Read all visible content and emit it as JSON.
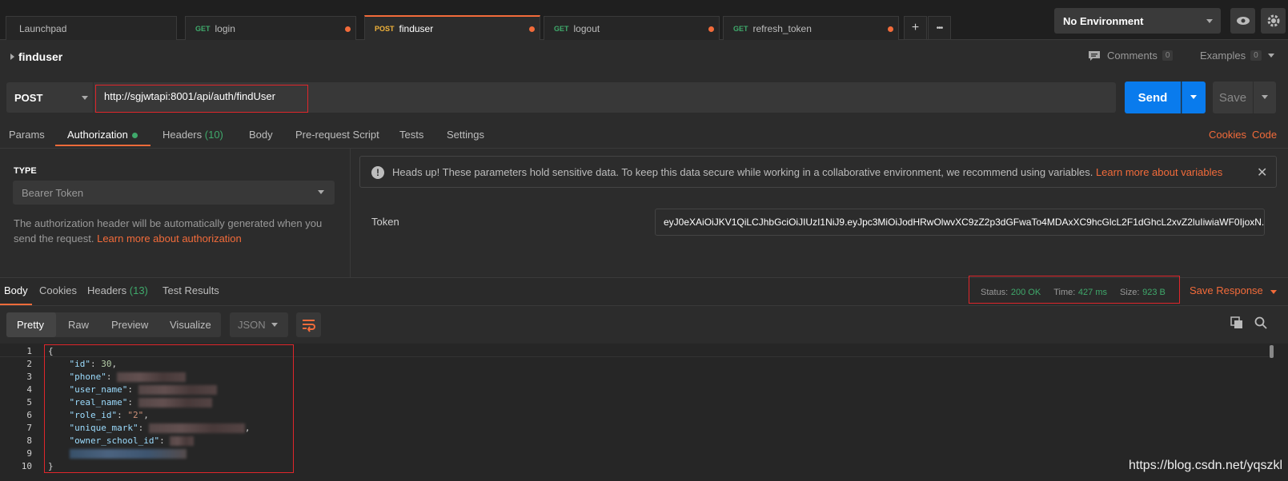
{
  "tabs": [
    {
      "method": "",
      "label": "Launchpad",
      "dirty": false
    },
    {
      "method": "GET",
      "label": "login",
      "dirty": true
    },
    {
      "method": "POST",
      "label": "finduser",
      "dirty": true,
      "active": true
    },
    {
      "method": "GET",
      "label": "logout",
      "dirty": true
    },
    {
      "method": "GET",
      "label": "refresh_token",
      "dirty": true
    }
  ],
  "tab_actions": {
    "new_tab": "+",
    "more": "•••"
  },
  "environment": {
    "selected": "No Environment"
  },
  "request": {
    "name": "finduser",
    "comments_label": "Comments",
    "comments_count": "0",
    "examples_label": "Examples",
    "examples_count": "0",
    "method": "POST",
    "url": "http://sgjwtapi:8001/api/auth/findUser",
    "send_label": "Send",
    "save_label": "Save"
  },
  "request_tabs": {
    "params": "Params",
    "authorization": "Authorization",
    "headers": "Headers",
    "headers_count": "(10)",
    "body": "Body",
    "prerequest": "Pre-request Script",
    "tests": "Tests",
    "settings": "Settings",
    "cookies": "Cookies",
    "code": "Code"
  },
  "auth": {
    "type_label": "TYPE",
    "type_value": "Bearer Token",
    "description": "The authorization header will be automatically generated when you send the request.",
    "learn_more": "Learn more about authorization",
    "headsup": "Heads up! These parameters hold sensitive data. To keep this data secure while working in a collaborative environment, we recommend using variables.",
    "headsup_link": "Learn more about variables",
    "token_label": "Token",
    "token_value": "eyJ0eXAiOiJKV1QiLCJhbGciOiJIUzI1NiJ9.eyJpc3MiOiJodHRwOlwvXC9zZ2p3dGFwaTo4MDAxXC9hcGlcL2F1dGhcL2xvZ2luIiwiaWF0IjoxN..."
  },
  "response": {
    "tabs": {
      "body": "Body",
      "cookies": "Cookies",
      "headers": "Headers",
      "headers_count": "(13)",
      "test_results": "Test Results"
    },
    "status_label": "Status:",
    "status_value": "200 OK",
    "time_label": "Time:",
    "time_value": "427 ms",
    "size_label": "Size:",
    "size_value": "923 B",
    "save_response": "Save Response",
    "formats": {
      "pretty": "Pretty",
      "raw": "Raw",
      "preview": "Preview",
      "visualize": "Visualize"
    },
    "language": "JSON"
  },
  "code_lines": {
    "l1": "{",
    "l2_key": "\"id\"",
    "l2_val": "30",
    "l3_key": "\"phone\"",
    "l4_key": "\"user_name\"",
    "l5_key": "\"real_name\"",
    "l6_key": "\"role_id\"",
    "l6_val": "\"2\"",
    "l7_key": "\"unique_mark\"",
    "l8_key": "\"owner_school_id\"",
    "l10": "}"
  },
  "line_numbers": [
    "1",
    "2",
    "3",
    "4",
    "5",
    "6",
    "7",
    "8",
    "9",
    "10"
  ],
  "watermark": "https://blog.csdn.net/yqszkl",
  "colors": {
    "accent": "#f26b3a",
    "send_blue": "#097bed",
    "ok_green": "#3fa96b",
    "highlight_red": "#e0262b"
  }
}
